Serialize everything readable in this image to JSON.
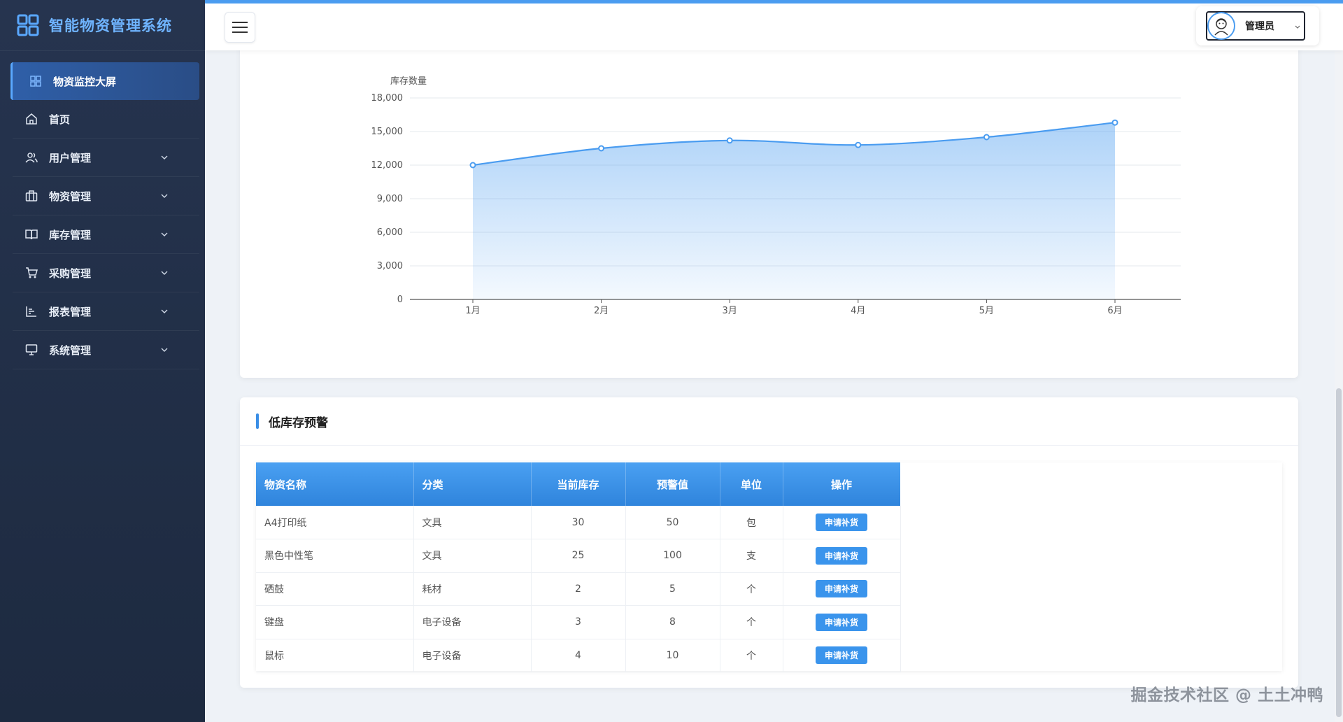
{
  "app": {
    "title": "智能物资管理系统"
  },
  "sidebar": {
    "items": [
      {
        "label": "物资监控大屏",
        "icon": "dashboard-grid-icon",
        "active": true,
        "expandable": false
      },
      {
        "label": "首页",
        "icon": "home-icon",
        "active": false,
        "expandable": false
      },
      {
        "label": "用户管理",
        "icon": "users-icon",
        "active": false,
        "expandable": true
      },
      {
        "label": "物资管理",
        "icon": "briefcase-icon",
        "active": false,
        "expandable": true
      },
      {
        "label": "库存管理",
        "icon": "book-icon",
        "active": false,
        "expandable": true
      },
      {
        "label": "采购管理",
        "icon": "cart-icon",
        "active": false,
        "expandable": true
      },
      {
        "label": "报表管理",
        "icon": "bar-chart-icon",
        "active": false,
        "expandable": true
      },
      {
        "label": "系统管理",
        "icon": "monitor-icon",
        "active": false,
        "expandable": true
      }
    ]
  },
  "header": {
    "menu_toggle_icon": "hamburger-icon",
    "user": {
      "name": "管理员",
      "avatar_icon": "user-avatar-icon"
    }
  },
  "chart_data": {
    "type": "area",
    "ylabel": "库存数量",
    "categories": [
      "1月",
      "2月",
      "3月",
      "4月",
      "5月",
      "6月"
    ],
    "series": [
      {
        "values": [
          12000,
          13500,
          14200,
          13800,
          14500,
          15800
        ]
      }
    ],
    "ylim": [
      0,
      18000
    ],
    "yticks": [
      "0",
      "3,000",
      "6,000",
      "9,000",
      "12,000",
      "15,000",
      "18,000"
    ],
    "grid": true,
    "color": "#4a9cf0"
  },
  "low_stock": {
    "title": "低库存预警",
    "columns": [
      "物资名称",
      "分类",
      "当前库存",
      "预警值",
      "单位",
      "操作"
    ],
    "rows": [
      {
        "name": "A4打印纸",
        "category": "文具",
        "stock": "30",
        "threshold": "50",
        "unit": "包",
        "action": "申请补货"
      },
      {
        "name": "黑色中性笔",
        "category": "文具",
        "stock": "25",
        "threshold": "100",
        "unit": "支",
        "action": "申请补货"
      },
      {
        "name": "硒鼓",
        "category": "耗材",
        "stock": "2",
        "threshold": "5",
        "unit": "个",
        "action": "申请补货"
      },
      {
        "name": "键盘",
        "category": "电子设备",
        "stock": "3",
        "threshold": "8",
        "unit": "个",
        "action": "申请补货"
      },
      {
        "name": "鼠标",
        "category": "电子设备",
        "stock": "4",
        "threshold": "10",
        "unit": "个",
        "action": "申请补货"
      }
    ]
  },
  "watermark": "掘金技术社区 @ 土土冲鸭"
}
